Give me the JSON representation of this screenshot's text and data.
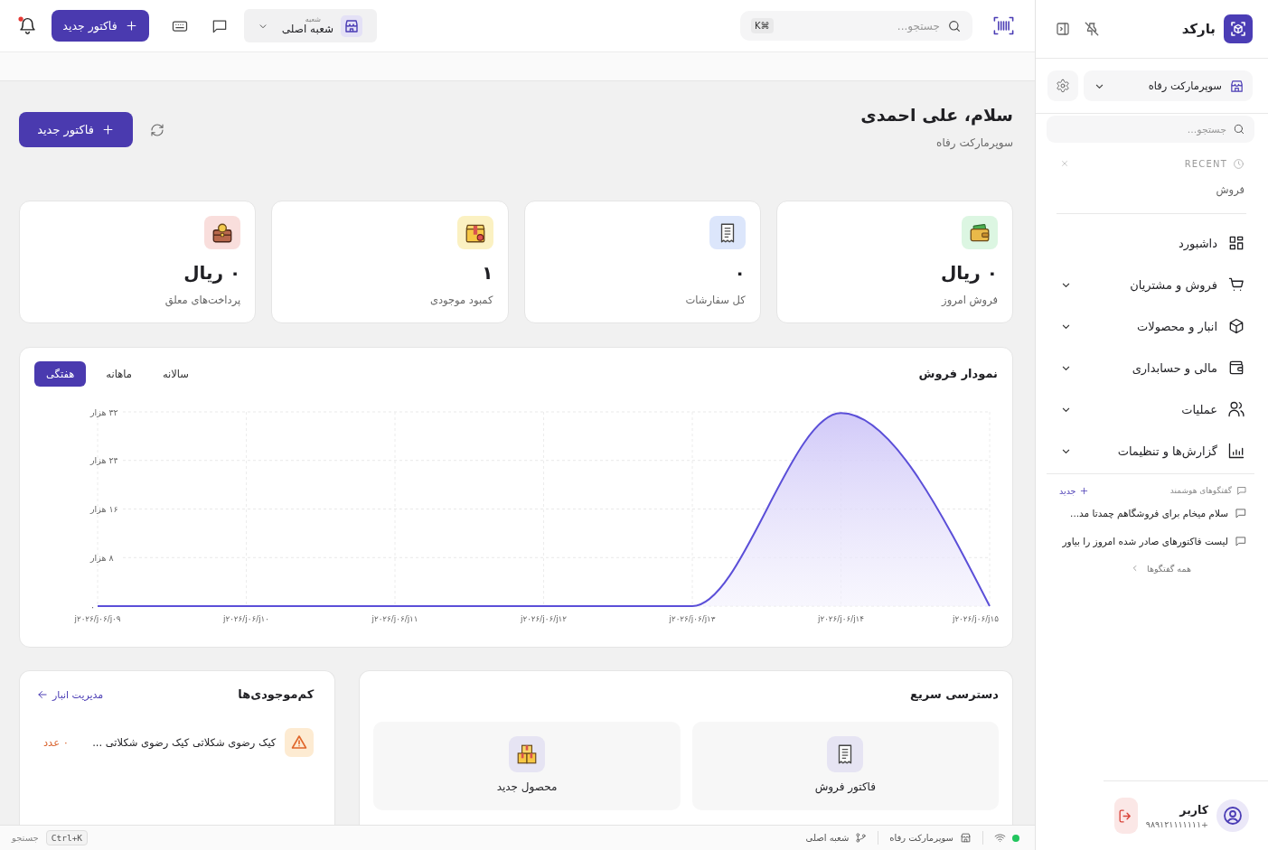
{
  "sidebar": {
    "brand": "بارکد",
    "store_selector": {
      "value": "سوپرمارکت رفاه"
    },
    "search": {
      "placeholder": "جستجو..."
    },
    "recent": {
      "heading": "RECENT",
      "items": [
        {
          "label": "فروش"
        }
      ]
    },
    "nav": [
      {
        "label": "داشبورد",
        "kind": "link"
      },
      {
        "label": "فروش و مشتریان",
        "kind": "group"
      },
      {
        "label": "انبار و محصولات",
        "kind": "group"
      },
      {
        "label": "مالی و حسابداری",
        "kind": "group"
      },
      {
        "label": "عملیات",
        "kind": "group"
      },
      {
        "label": "گزارش‌ها و تنظیمات",
        "kind": "group"
      }
    ],
    "smart_chats": {
      "heading": "گفتگوهای هوشمند",
      "new_link": "جدید",
      "items": [
        {
          "title": "سلام میخام برای فروشگاهم چمدتا مد..."
        },
        {
          "title": "لیست فاکتورهای صادر شده امروز را بیاور"
        }
      ],
      "all_link": "همه گفتگوها"
    },
    "user": {
      "name": "کاربر",
      "phone": "+۹۸۹۱۲۱۱۱۱۱۱۱"
    }
  },
  "topbar": {
    "search": {
      "placeholder": "جستجو...",
      "shortcut": "⌘K"
    },
    "branch_selector": {
      "label": "شعبه",
      "value": "شعبه اصلی"
    },
    "new_invoice_button": "فاکتور جدید",
    "notifications_unread": true
  },
  "greeting": {
    "title": "سلام، علی احمدی",
    "subtitle": "سوپرمارکت رفاه",
    "new_invoice_button": "فاکتور جدید"
  },
  "stats": [
    {
      "value": "۰ ریال",
      "label": "فروش امروز",
      "color": "#dcf6e2"
    },
    {
      "value": "۰",
      "label": "کل سفارشات",
      "color": "#dce6fb"
    },
    {
      "value": "۱",
      "label": "کمبود موجودی",
      "color": "#fbf1c2"
    },
    {
      "value": "۰ ریال",
      "label": "پرداخت‌های معلق",
      "color": "#f9dedc"
    }
  ],
  "sales_chart": {
    "title": "نمودار فروش",
    "tabs": [
      {
        "label": "سالانه",
        "selected": false
      },
      {
        "label": "ماهانه",
        "selected": false
      },
      {
        "label": "هفتگی",
        "selected": true
      }
    ],
    "chart_data": {
      "type": "area",
      "categories": [
        "j۲۰۲۶/j۰۶/j۰۹",
        "j۲۰۲۶/j۰۶/j۱۰",
        "j۲۰۲۶/j۰۶/j۱۱",
        "j۲۰۲۶/j۰۶/j۱۲",
        "j۲۰۲۶/j۰۶/j۱۳",
        "j۲۰۲۶/j۰۶/j۱۴",
        "j۲۰۲۶/j۰۶/j۱۵"
      ],
      "series": [
        {
          "color": "#5b4fd8",
          "values": [
            0,
            0,
            0,
            0,
            0,
            31.8,
            0
          ]
        }
      ],
      "ylim": [
        0,
        32
      ],
      "yticks": [
        {
          "value": 0,
          "label": "۰"
        },
        {
          "value": 8,
          "label": "۸ هزار"
        },
        {
          "value": 16,
          "label": "۱۶ هزار"
        },
        {
          "value": 24,
          "label": "۲۴ هزار"
        },
        {
          "value": 32,
          "label": "۳۲ هزار"
        }
      ],
      "grid": true
    }
  },
  "quick_access": {
    "title": "دسترسی سریع",
    "items": [
      {
        "label": "فاکتور فروش"
      },
      {
        "label": "محصول جدید"
      }
    ]
  },
  "low_stock": {
    "title": "کم‌موجودی‌ها",
    "link": "مدیریت انبار",
    "items": [
      {
        "name": "کیک رضوی شکلاتی کیک رضوی شکلاتی ...",
        "quantity": "۰ عدد"
      }
    ]
  },
  "status_bar": {
    "connected": true,
    "store": "سوپرمارکت رفاه",
    "branch": "شعبه اصلی",
    "search_shortcut": "Ctrl+K",
    "search_label": "جستجو"
  }
}
